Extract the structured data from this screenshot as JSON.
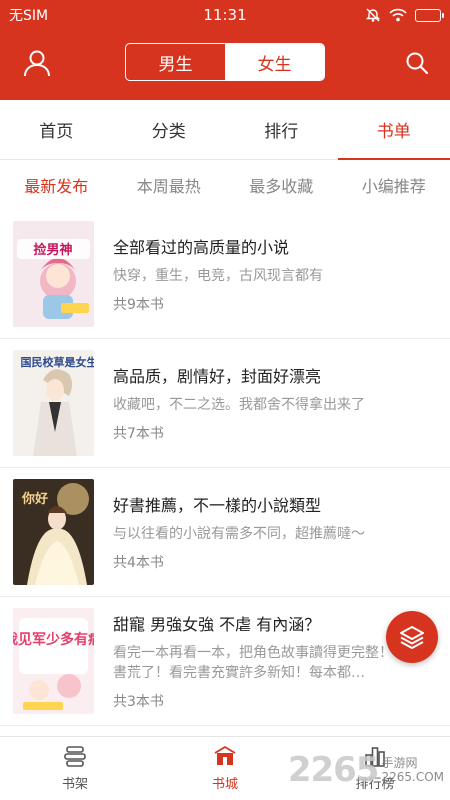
{
  "status_bar": {
    "carrier": "无SIM",
    "time": "11:31"
  },
  "header": {
    "gender_toggle": {
      "male_label": "男生",
      "female_label": "女生",
      "selected": "女生"
    },
    "icons": {
      "left": "user-icon",
      "right": "search-icon"
    },
    "accent_color": "#d7341f"
  },
  "main_tabs": [
    {
      "label": "首页"
    },
    {
      "label": "分类"
    },
    {
      "label": "排行"
    },
    {
      "label": "书单",
      "active": true
    }
  ],
  "sub_tabs": [
    {
      "label": "最新发布",
      "active": true
    },
    {
      "label": "本周最热"
    },
    {
      "label": "最多收藏"
    },
    {
      "label": "小编推荐"
    }
  ],
  "books": [
    {
      "title": "全部看过的高质量的小说",
      "desc": "快穿，重生，电竞，古风现言都有",
      "count": "共9本书",
      "cover_text": "捡男神"
    },
    {
      "title": "高品质，剧情好，封面好漂亮",
      "desc": "收藏吧，不二之选。我都舍不得拿出来了",
      "count": "共7本书",
      "cover_text": "国民校草是女生"
    },
    {
      "title": "好書推薦，不一樣的小說類型",
      "desc": "与以往看的小說有需多不同，超推薦噠～",
      "count": "共4本书",
      "cover_text": "你好"
    },
    {
      "title": "甜寵 男強女強 不虐 有內涵？",
      "desc": "看完一本再看一本，把角色故事讀得更完整！不怕書荒了！看完書充實許多新知！每本都…",
      "count": "共3本书",
      "cover_text": "我见军少多有病"
    }
  ],
  "fab": {
    "icon": "layers-icon"
  },
  "bottom_nav": [
    {
      "label": "书架",
      "icon": "bookshelf-icon"
    },
    {
      "label": "书城",
      "icon": "bookstore-icon",
      "active": true
    },
    {
      "label": "排行榜",
      "icon": "ranking-icon"
    }
  ],
  "watermark": {
    "number": "2265",
    "cn": "手游网",
    "en": "2265.COM"
  }
}
